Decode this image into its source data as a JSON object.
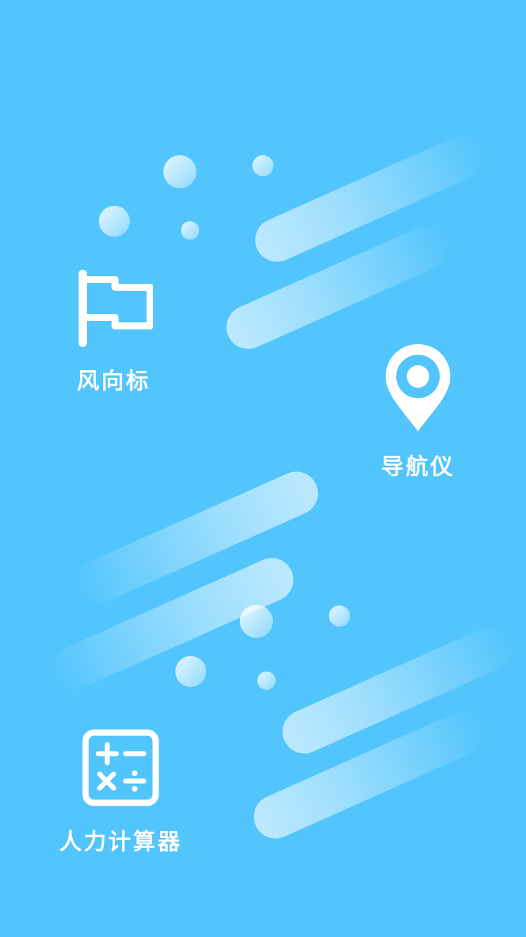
{
  "colors": {
    "background": "#52c5fc",
    "foreground": "#ffffff"
  },
  "features": {
    "wind_vane": {
      "label": "风向标",
      "icon": "flag-icon"
    },
    "navigator": {
      "label": "导航仪",
      "icon": "map-pin-icon"
    },
    "calculator": {
      "label": "人力计算器",
      "icon": "calculator-icon"
    }
  }
}
